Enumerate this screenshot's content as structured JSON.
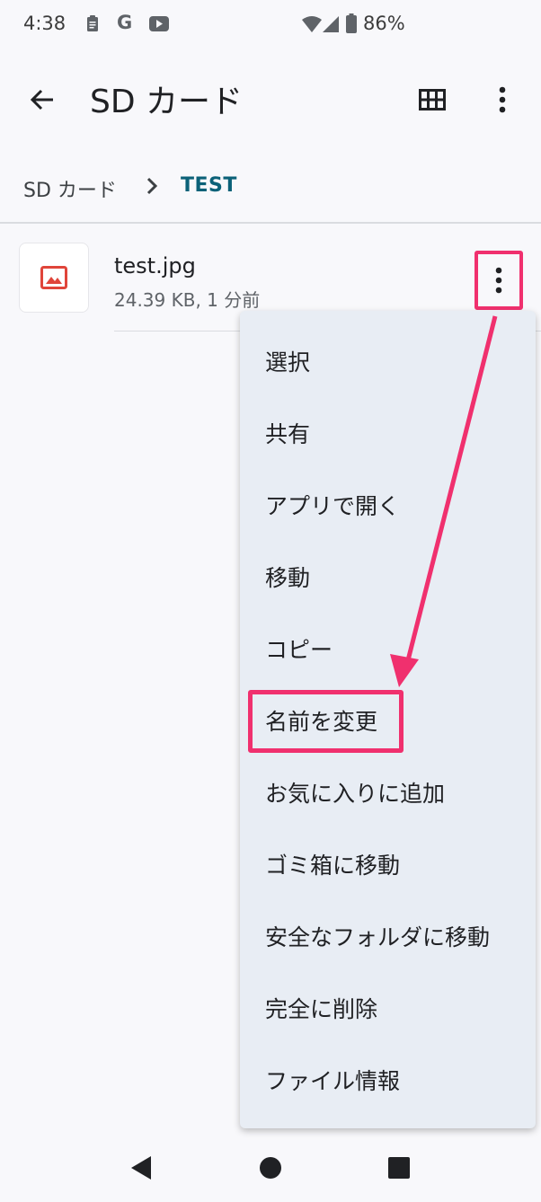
{
  "status_bar": {
    "time": "4:38",
    "battery": "86%",
    "icons": [
      "clipboard-icon",
      "google-icon",
      "youtube-icon",
      "wifi-icon",
      "signal-icon",
      "battery-icon"
    ],
    "google_letter": "G"
  },
  "app_bar": {
    "title": "SD カード",
    "back_icon": "back-arrow-icon",
    "grid_icon": "grid-view-icon",
    "menu_icon": "more-vert-icon"
  },
  "breadcrumb": {
    "root": "SD カード",
    "separator_icon": "chevron-right-icon",
    "current": "TEST"
  },
  "file": {
    "name": "test.jpg",
    "meta": "24.39 KB, 1 分前",
    "icon": "image-icon",
    "icon_color": "#e0453a"
  },
  "context_menu": {
    "items": [
      {
        "label": "選択"
      },
      {
        "label": "共有"
      },
      {
        "label": "アプリで開く"
      },
      {
        "label": "移動"
      },
      {
        "label": "コピー"
      },
      {
        "label": "名前を変更"
      },
      {
        "label": "お気に入りに追加"
      },
      {
        "label": "ゴミ箱に移動"
      },
      {
        "label": "安全なフォルダに移動"
      },
      {
        "label": "完全に削除"
      },
      {
        "label": "ファイル情報"
      }
    ]
  },
  "annotation": {
    "color": "#f0306e"
  },
  "nav_bar": {
    "icons": [
      "back-triangle-icon",
      "home-circle-icon",
      "recents-square-icon"
    ]
  },
  "colors": {
    "background": "#f8f8fb",
    "menu_background": "#e8edf4",
    "breadcrumb_active": "#0b6178"
  }
}
